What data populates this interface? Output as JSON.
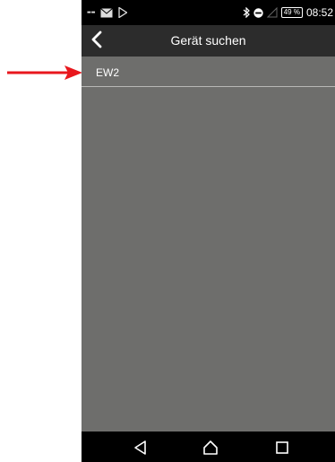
{
  "status_bar": {
    "battery": "49 %",
    "time": "08:52",
    "icons": [
      "notification-icon",
      "mail-icon",
      "play-store-icon",
      "bluetooth-icon",
      "dnd-icon",
      "signal-icon",
      "battery-icon"
    ]
  },
  "app_bar": {
    "title": "Gerät suchen",
    "back_icon": "chevron-left-icon"
  },
  "devices": [
    {
      "name": "EW2"
    }
  ],
  "annotation": {
    "color": "#e8171d",
    "icon": "right-arrow-icon"
  },
  "nav_bar": {
    "icons": [
      "back-triangle-icon",
      "home-icon",
      "recents-icon"
    ]
  }
}
